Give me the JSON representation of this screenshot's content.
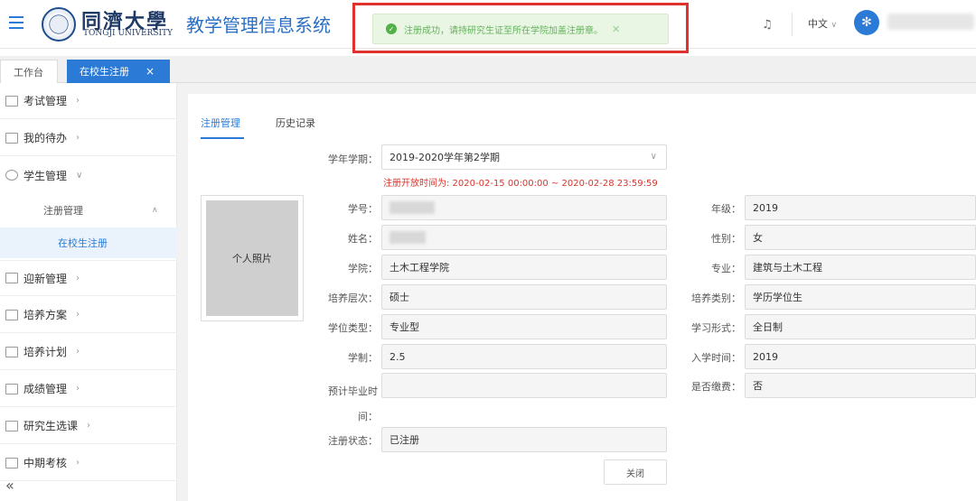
{
  "header": {
    "logo_cn": "同濟大學",
    "logo_en": "TONGJI UNIVERSITY",
    "system_title": "教学管理信息系统",
    "toast": "注册成功，请持研究生证至所在学院加盖注册章。",
    "language": "中文"
  },
  "tabs": {
    "workbench": "工作台",
    "active": "在校生注册"
  },
  "sidebar": {
    "items": [
      {
        "label": "考试管理"
      },
      {
        "label": "我的待办"
      },
      {
        "label": "学生管理"
      },
      {
        "label": "迎新管理"
      },
      {
        "label": "培养方案"
      },
      {
        "label": "培养计划"
      },
      {
        "label": "成绩管理"
      },
      {
        "label": "研究生选课"
      },
      {
        "label": "中期考核"
      }
    ],
    "sub_l2": "注册管理",
    "sub_l3": "在校生注册"
  },
  "main": {
    "subtabs": [
      "注册管理",
      "历史记录"
    ],
    "term_label": "学年学期：",
    "term_value": "2019-2020学年第2学期",
    "notice": "注册开放时间为: 2020-02-15 00:00:00 ~ 2020-02-28 23:59:59",
    "photo_label": "个人照片",
    "left_fields": [
      {
        "label": "学号：",
        "value": ""
      },
      {
        "label": "姓名：",
        "value": ""
      },
      {
        "label": "学院：",
        "value": "土木工程学院"
      },
      {
        "label": "培养层次：",
        "value": "硕士"
      },
      {
        "label": "学位类型：",
        "value": "专业型"
      },
      {
        "label": "学制：",
        "value": "2.5"
      },
      {
        "label": "预计毕业时间：",
        "value": ""
      },
      {
        "label": "注册状态：",
        "value": "已注册"
      }
    ],
    "right_fields": [
      {
        "label": "年级：",
        "value": "2019"
      },
      {
        "label": "性别：",
        "value": "女"
      },
      {
        "label": "专业：",
        "value": "建筑与土木工程"
      },
      {
        "label": "培养类别：",
        "value": "学历学位生"
      },
      {
        "label": "学习形式：",
        "value": "全日制"
      },
      {
        "label": "入学时间：",
        "value": "2019"
      },
      {
        "label": "是否缴费：",
        "value": "否"
      }
    ],
    "close_label": "关闭"
  }
}
